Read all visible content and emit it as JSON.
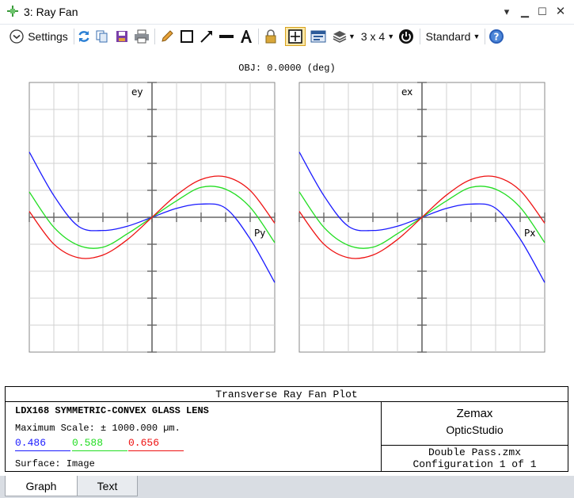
{
  "window": {
    "title": "3: Ray Fan",
    "icons": [
      "move-icon",
      "pin-down-icon",
      "minimize-icon",
      "maximize-icon",
      "close-icon"
    ]
  },
  "toolbar": {
    "settings_label": "Settings",
    "layout_label": "3 x 4",
    "style_label": "Standard"
  },
  "plot_header": "OBJ: 0.0000 (deg)",
  "chart_data": [
    {
      "type": "line",
      "ylabel": "ey",
      "xlabel": "Py",
      "xlim": [
        -1,
        1
      ],
      "ylim": [
        -1,
        1
      ],
      "grid": true,
      "series": [
        {
          "name": "0.486",
          "color": "#1a1aff",
          "x": [
            -1,
            -0.8,
            -0.6,
            -0.4,
            -0.2,
            0,
            0.2,
            0.4,
            0.6,
            0.8,
            1
          ],
          "y": [
            0.484,
            0.161,
            -0.067,
            -0.098,
            -0.066,
            0,
            0.066,
            0.098,
            0.067,
            -0.161,
            -0.484
          ]
        },
        {
          "name": "0.588",
          "color": "#22dd22",
          "x": [
            -1,
            -0.8,
            -0.6,
            -0.4,
            -0.2,
            0,
            0.2,
            0.4,
            0.6,
            0.8,
            1
          ],
          "y": [
            0.188,
            -0.074,
            -0.208,
            -0.222,
            -0.122,
            0,
            0.122,
            0.222,
            0.208,
            0.074,
            -0.188
          ]
        },
        {
          "name": "0.656",
          "color": "#ee1111",
          "x": [
            -1,
            -0.8,
            -0.6,
            -0.4,
            -0.2,
            0,
            0.2,
            0.4,
            0.6,
            0.8,
            1
          ],
          "y": [
            0.044,
            -0.199,
            -0.3,
            -0.28,
            -0.165,
            0,
            0.165,
            0.28,
            0.3,
            0.199,
            -0.044
          ]
        }
      ]
    },
    {
      "type": "line",
      "ylabel": "ex",
      "xlabel": "Px",
      "xlim": [
        -1,
        1
      ],
      "ylim": [
        -1,
        1
      ],
      "grid": true,
      "series": [
        {
          "name": "0.486",
          "color": "#1a1aff",
          "x": [
            -1,
            -0.8,
            -0.6,
            -0.4,
            -0.2,
            0,
            0.2,
            0.4,
            0.6,
            0.8,
            1
          ],
          "y": [
            0.484,
            0.161,
            -0.067,
            -0.098,
            -0.066,
            0,
            0.066,
            0.098,
            0.067,
            -0.161,
            -0.484
          ]
        },
        {
          "name": "0.588",
          "color": "#22dd22",
          "x": [
            -1,
            -0.8,
            -0.6,
            -0.4,
            -0.2,
            0,
            0.2,
            0.4,
            0.6,
            0.8,
            1
          ],
          "y": [
            0.188,
            -0.074,
            -0.208,
            -0.222,
            -0.122,
            0,
            0.122,
            0.222,
            0.208,
            0.074,
            -0.188
          ]
        },
        {
          "name": "0.656",
          "color": "#ee1111",
          "x": [
            -1,
            -0.8,
            -0.6,
            -0.4,
            -0.2,
            0,
            0.2,
            0.4,
            0.6,
            0.8,
            1
          ],
          "y": [
            0.044,
            -0.199,
            -0.3,
            -0.28,
            -0.165,
            0,
            0.165,
            0.28,
            0.3,
            0.199,
            -0.044
          ]
        }
      ]
    }
  ],
  "info": {
    "title": "Transverse Ray Fan Plot",
    "lens": "LDX168 SYMMETRIC-CONVEX GLASS LENS",
    "max_scale": "Maximum Scale: ± 1000.000 µm.",
    "wavelengths": [
      {
        "label": "0.486",
        "color": "#1a1aff"
      },
      {
        "label": "0.588",
        "color": "#22dd22"
      },
      {
        "label": "0.656",
        "color": "#ee1111"
      }
    ],
    "surface": "Surface: Image",
    "brand_name": "Zemax",
    "brand_product": "OpticStudio",
    "file_name": "Double Pass.zmx",
    "configuration": "Configuration 1 of 1"
  },
  "tabs": [
    {
      "label": "Graph",
      "active": true
    },
    {
      "label": "Text",
      "active": false
    }
  ]
}
